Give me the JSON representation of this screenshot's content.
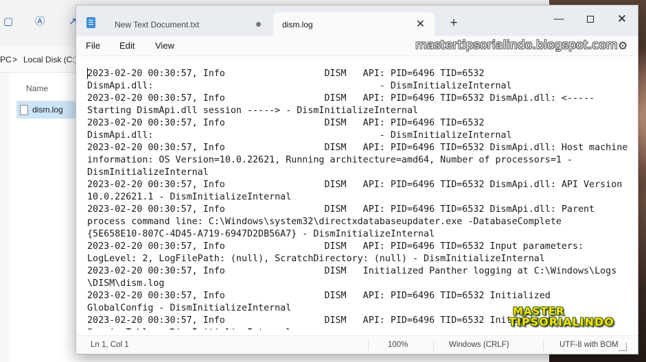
{
  "explorer": {
    "address": {
      "pc_label": "PC",
      "separator": ">",
      "drive_label": "Local Disk (C:)"
    },
    "column_header": "Name",
    "file": {
      "name": "dism.log"
    }
  },
  "notepad": {
    "tabs": [
      {
        "label": "New Text Document.txt",
        "modified": true
      },
      {
        "label": "dism.log",
        "active": true
      }
    ],
    "new_tab_label": "+",
    "window_controls": {
      "minimize": "—",
      "maximize": "",
      "close": "✕"
    },
    "menu": [
      "File",
      "Edit",
      "View"
    ],
    "watermark_top": "mastertipsorialindo.blogspot.com",
    "log_lines": [
      "2023-02-20 00:30:57, Info                  DISM   API: PID=6496 TID=6532",
      "DismApi.dll:                                         - DismInitializeInternal",
      "2023-02-20 00:30:57, Info                  DISM   API: PID=6496 TID=6532 DismApi.dll: <-----",
      "Starting DismApi.dll session -----> - DismInitializeInternal",
      "2023-02-20 00:30:57, Info                  DISM   API: PID=6496 TID=6532",
      "DismApi.dll:                                         - DismInitializeInternal",
      "2023-02-20 00:30:57, Info                  DISM   API: PID=6496 TID=6532 DismApi.dll: Host machine",
      "information: OS Version=10.0.22621, Running architecture=amd64, Number of processors=1 -",
      "DismInitializeInternal",
      "2023-02-20 00:30:57, Info                  DISM   API: PID=6496 TID=6532 DismApi.dll: API Version",
      "10.0.22621.1 - DismInitializeInternal",
      "2023-02-20 00:30:57, Info                  DISM   API: PID=6496 TID=6532 DismApi.dll: Parent",
      "process command line: C:\\Windows\\system32\\directxdatabaseupdater.exe -DatabaseComplete",
      "{5E658E10-807C-4D45-A719-6947D2DB56A7} - DismInitializeInternal",
      "2023-02-20 00:30:57, Info                  DISM   API: PID=6496 TID=6532 Input parameters:",
      "LogLevel: 2, LogFilePath: (null), ScratchDirectory: (null) - DismInitializeInternal",
      "2023-02-20 00:30:57, Info                  DISM   Initialized Panther logging at C:\\Windows\\Logs",
      "\\DISM\\dism.log",
      "2023-02-20 00:30:57, Info                  DISM   API: PID=6496 TID=6532 Initialized",
      "GlobalConfig - DismInitializeInternal",
      "2023-02-20 00:30:57, Info                  DISM   API: PID=6496 TID=6532 Initialized",
      "SessionTable - DismInitializeInternal"
    ],
    "status": {
      "position": "Ln 1, Col 1",
      "zoom": "100%",
      "line_ending": "Windows (CRLF)",
      "encoding": "UTF-8 with BOM"
    },
    "logo_watermark": {
      "line1": "MASTER",
      "line2": "TIPSORIALINDO"
    }
  },
  "colors": {
    "tabstrip": "#e9ecf1",
    "logo_yellow": "#ffe000",
    "selection": "#cce4f7"
  }
}
